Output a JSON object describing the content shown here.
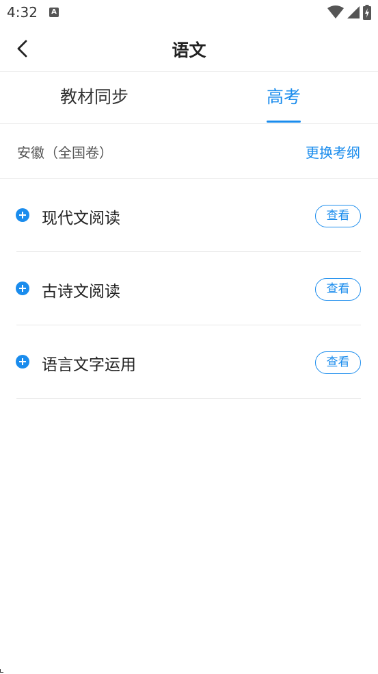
{
  "status_bar": {
    "time": "4:32",
    "notification_icon": "text-a-icon",
    "notification_glyph": "A",
    "icons": [
      "wifi-icon",
      "cell-signal-icon",
      "battery-charging-icon"
    ]
  },
  "header": {
    "back_icon": "chevron-left-icon",
    "title": "语文"
  },
  "tabs": [
    {
      "label": "教材同步",
      "active": false
    },
    {
      "label": "高考",
      "active": true
    }
  ],
  "region": {
    "label": "安徽（全国卷）",
    "action": "更换考纲"
  },
  "topics": [
    {
      "label": "现代文阅读",
      "action": "查看"
    },
    {
      "label": "古诗文阅读",
      "action": "查看"
    },
    {
      "label": "语言文字运用",
      "action": "查看"
    }
  ],
  "colors": {
    "accent": "#1a8ced",
    "text": "#222222",
    "divider": "#eeeeee"
  }
}
